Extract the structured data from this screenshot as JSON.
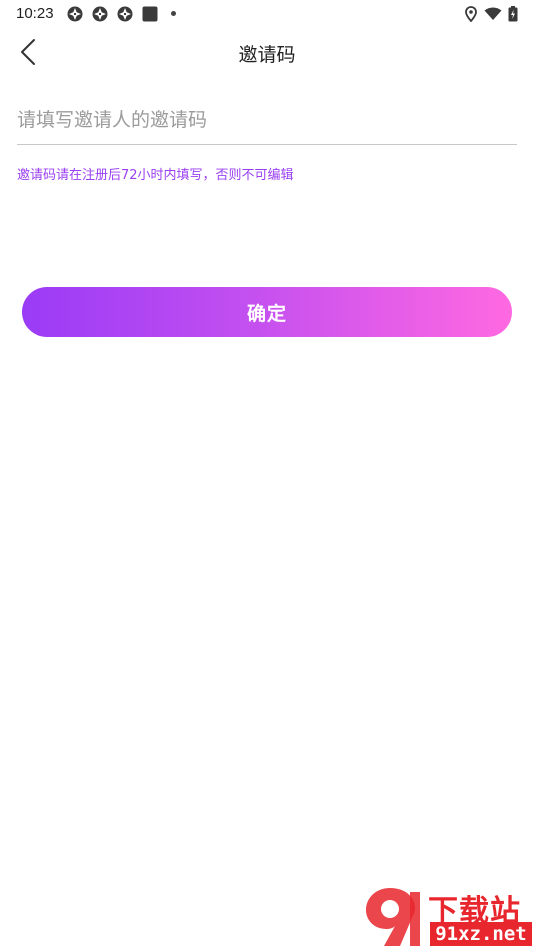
{
  "status_bar": {
    "time": "10:23",
    "left_icons": [
      "app-icon",
      "app-icon",
      "app-icon",
      "square-icon",
      "dot-icon"
    ],
    "right_icons": [
      "location-icon",
      "wifi-icon",
      "battery-icon"
    ]
  },
  "header": {
    "title": "邀请码",
    "back_icon": "chevron-left-icon"
  },
  "form": {
    "placeholder": "请填写邀请人的邀请码",
    "value": "",
    "hint": "邀请码请在注册后72小时内填写，否则不可编辑",
    "confirm_label": "确定"
  },
  "watermark": {
    "brand": "下载站",
    "url": "91xz.net"
  },
  "colors": {
    "accent": "#9a3ff2",
    "gradient_start": "#9a3bf6",
    "gradient_end": "#ff69e1",
    "watermark_red": "#e8262d"
  }
}
